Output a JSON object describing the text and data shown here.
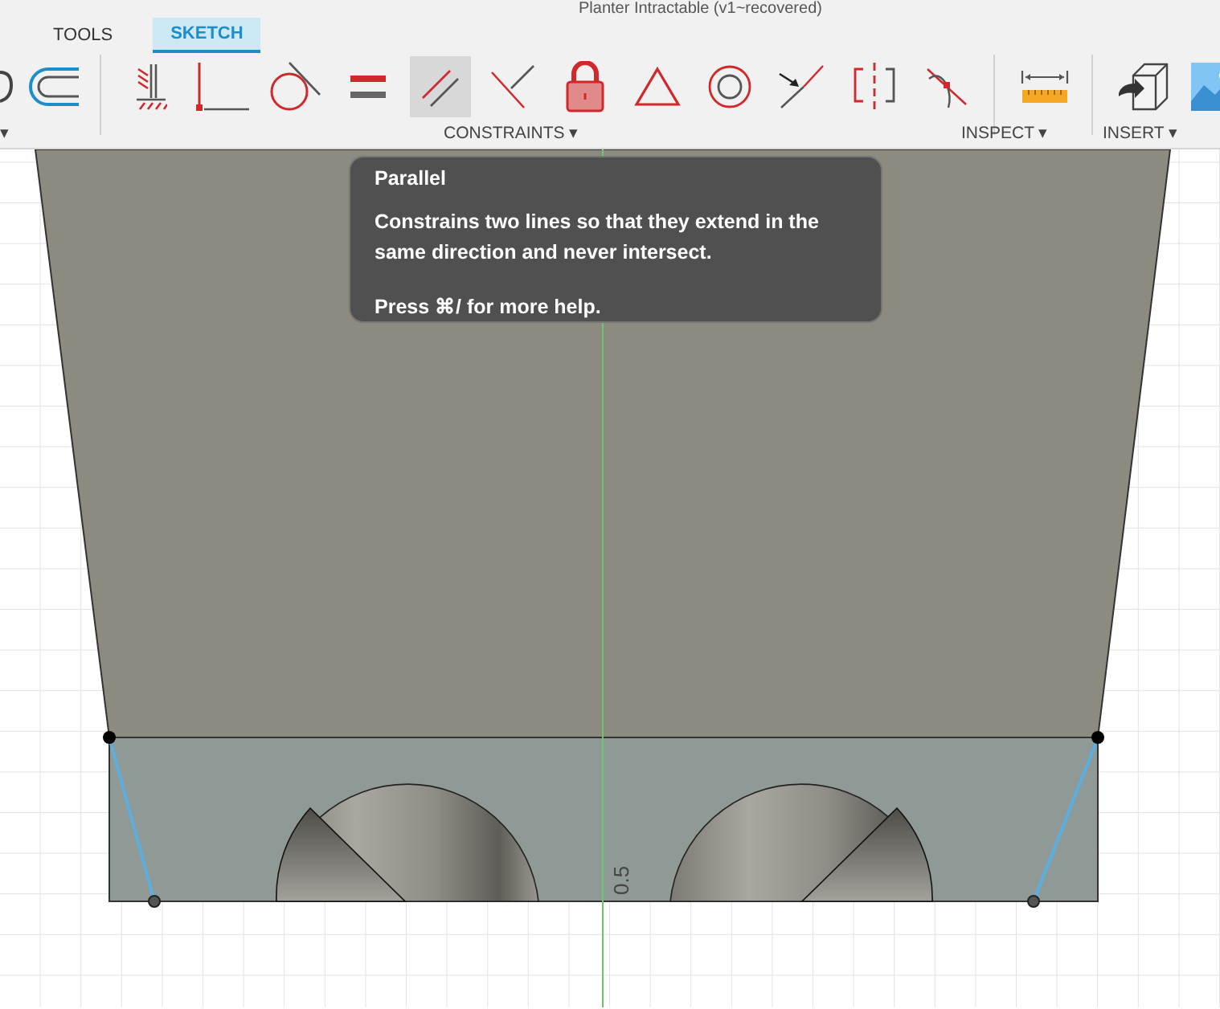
{
  "window": {
    "title": "Planter Intractable (v1~recovered)"
  },
  "tabs": [
    {
      "label": "TOOLS",
      "selected": false
    },
    {
      "label": "SKETCH",
      "selected": true
    }
  ],
  "toolbar": [
    {
      "kind": "partial",
      "selected": false
    },
    {
      "kind": "offset",
      "selected": false
    },
    {
      "kind": "divider"
    },
    {
      "kind": "fix",
      "selected": false
    },
    {
      "kind": "perpendicular",
      "selected": false
    },
    {
      "kind": "tangent",
      "selected": false
    },
    {
      "kind": "equal",
      "selected": false
    },
    {
      "kind": "parallel",
      "selected": true
    },
    {
      "kind": "collinear",
      "selected": false
    },
    {
      "kind": "lock",
      "selected": false
    },
    {
      "kind": "triangle",
      "selected": false
    },
    {
      "kind": "concentric",
      "selected": false
    },
    {
      "kind": "midpoint",
      "selected": false
    },
    {
      "kind": "symmetry",
      "selected": false
    },
    {
      "kind": "curvature",
      "selected": false
    },
    {
      "kind": "divider"
    },
    {
      "kind": "measure",
      "selected": false
    },
    {
      "kind": "divider"
    },
    {
      "kind": "derive",
      "selected": false
    },
    {
      "kind": "image",
      "selected": false
    }
  ],
  "groups": [
    {
      "label": "▾"
    },
    {
      "label": "CONSTRAINTS ▾"
    },
    {
      "label": "INSPECT ▾"
    },
    {
      "label": "INSERT ▾"
    }
  ],
  "tooltip": {
    "title": "Parallel",
    "description": "Constrains two lines so that they extend in the same direction and never intersect.",
    "hint": "Press ⌘/ for more help."
  },
  "dimension": "0.5"
}
